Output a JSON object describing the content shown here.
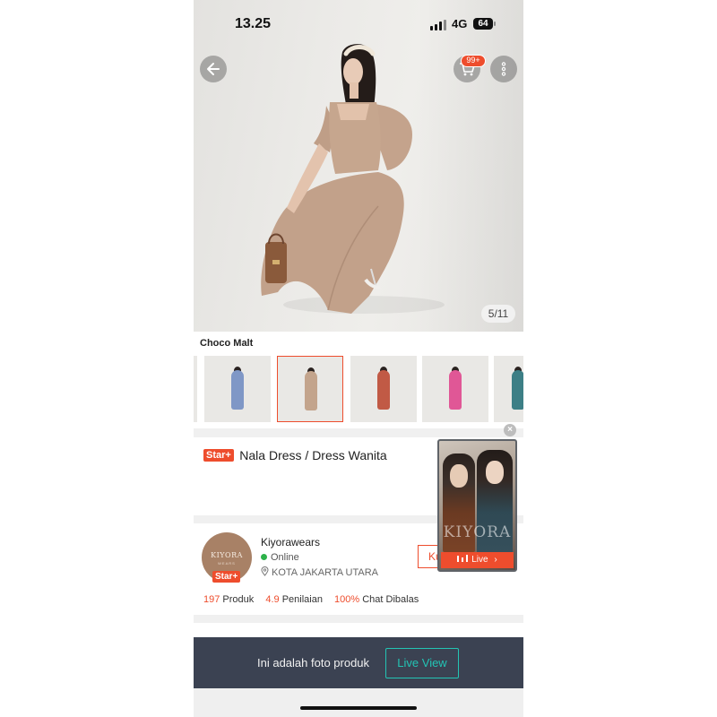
{
  "status_bar": {
    "time": "13.25",
    "network": "4G",
    "battery": "64"
  },
  "header": {
    "cart_badge": "99+"
  },
  "gallery": {
    "counter": "5/11",
    "variant_name": "Choco Malt"
  },
  "thumbnails": [
    {
      "dress_color": "#7f97c6"
    },
    {
      "dress_color": "#c3a48c"
    },
    {
      "dress_color": "#c15a45"
    },
    {
      "dress_color": "#e05796"
    },
    {
      "dress_color": "#3d7f86"
    }
  ],
  "product": {
    "badge": "Star+",
    "title": "Nala Dress / Dress Wanita"
  },
  "live_pip": {
    "brand": "KIYORA",
    "live_label": "Live"
  },
  "shop": {
    "logo_line1": "KIYORA",
    "logo_line2": "WEARS",
    "badge": "Star+",
    "name": "Kiyorawears",
    "status": "Online",
    "location": "KOTA JAKARTA UTARA",
    "visit_label": "Kunjungi",
    "stats": [
      {
        "value": "197",
        "label": "Produk"
      },
      {
        "value": "4.9",
        "label": "Penilaian"
      },
      {
        "value": "100%",
        "label": "Chat Dibalas"
      }
    ]
  },
  "banner": {
    "text": "Ini adalah foto produk",
    "button": "Live View"
  },
  "colors": {
    "accent": "#ee4d2d",
    "teal": "#23c4b4",
    "banner_bg": "#3b4252"
  }
}
